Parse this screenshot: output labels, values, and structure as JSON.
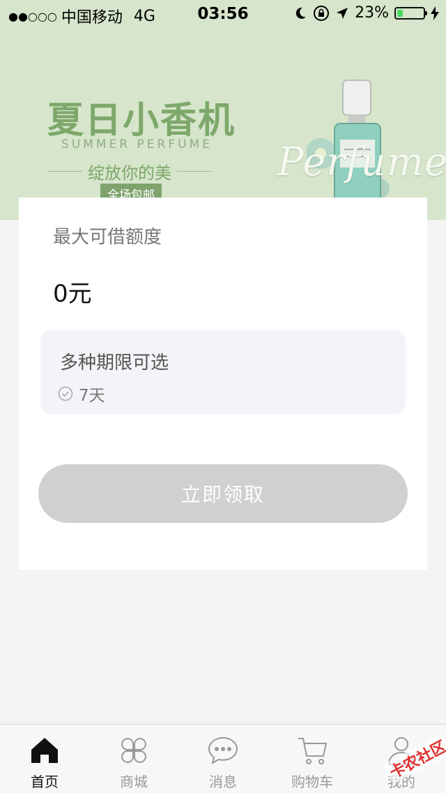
{
  "status_bar": {
    "signal": "●●○○○",
    "carrier": "中国移动",
    "network": "4G",
    "time": "03:56",
    "battery_percent": "23%",
    "battery_level": 0.23
  },
  "banner": {
    "title": "夏日小香机",
    "subtitle": "SUMMER PERFUME",
    "tagline": "绽放你的美",
    "badge": "全场包邮",
    "script_word": "Perfume"
  },
  "card": {
    "limit_label": "最大可借额度",
    "limit_amount": "0元",
    "term_title": "多种期限可选",
    "term_option": "7天",
    "claim_button": "立即领取"
  },
  "tabs": [
    {
      "label": "首页",
      "icon": "home-icon",
      "active": true
    },
    {
      "label": "商城",
      "icon": "clover-icon",
      "active": false
    },
    {
      "label": "消息",
      "icon": "chat-bubble-icon",
      "active": false
    },
    {
      "label": "购物车",
      "icon": "cart-icon",
      "active": false
    },
    {
      "label": "我的",
      "icon": "user-icon",
      "active": false
    }
  ],
  "watermark": "卡农社区",
  "colors": {
    "banner_bg": "#d6e5cb",
    "banner_green": "#7da86a",
    "button_disabled": "#d0d0d2",
    "battery_green": "#4cd964"
  }
}
